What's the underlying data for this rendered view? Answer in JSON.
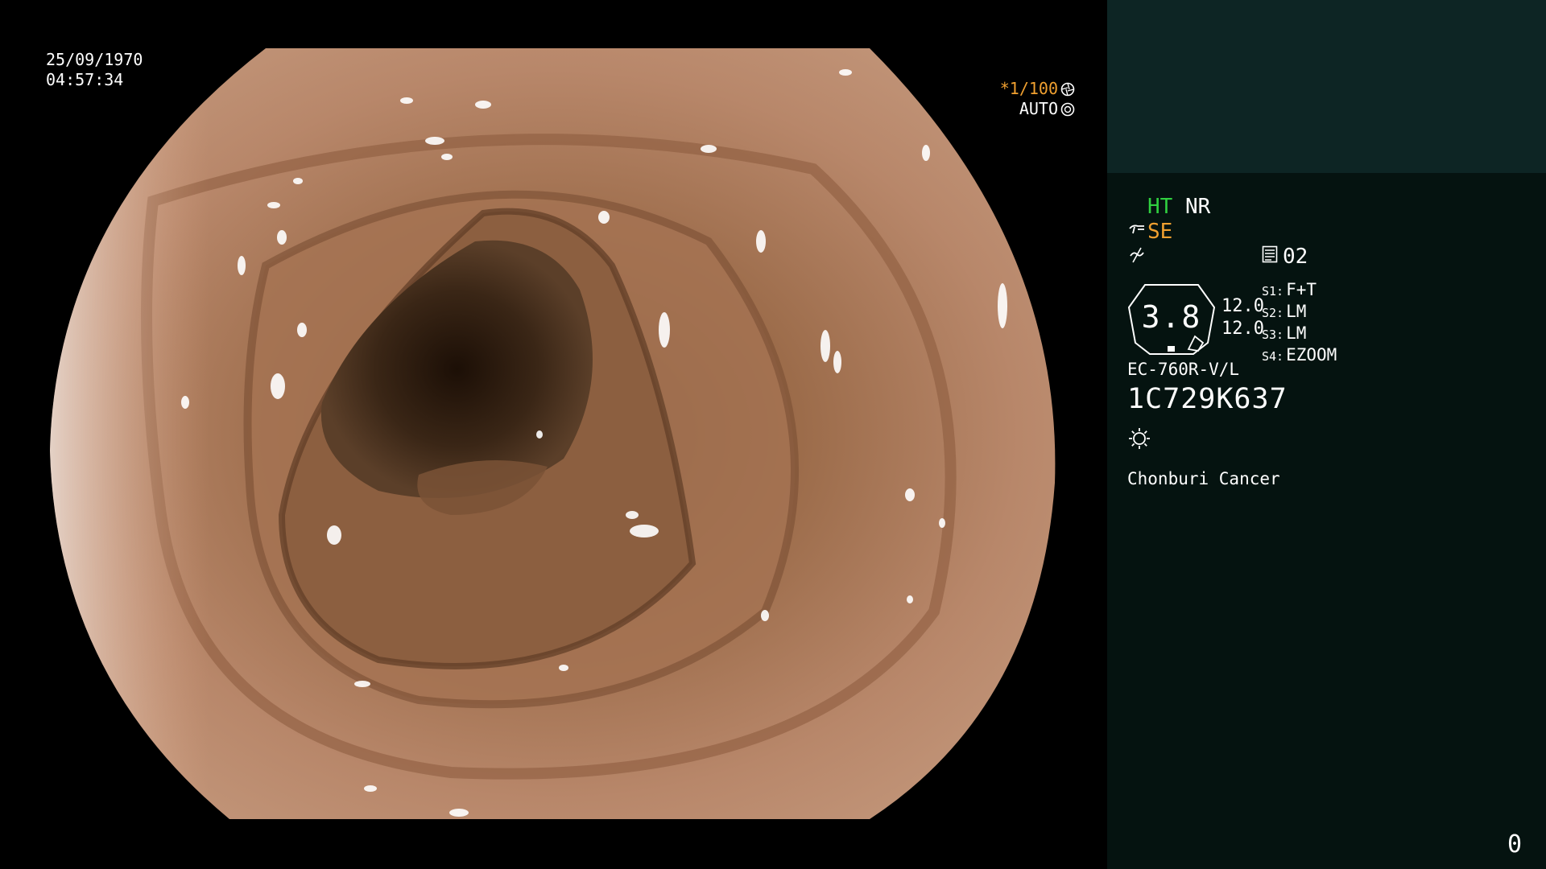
{
  "video": {
    "date": "25/09/1970",
    "time": "04:57:34",
    "shutter": "*1/100",
    "shutter_icon": "aperture-icon",
    "iris": "AUTO",
    "iris_icon": "iris-icon"
  },
  "panel": {
    "ht": "HT",
    "nr": "NR",
    "se": "SE",
    "memory": "02",
    "zoom": "3.8",
    "scale_top": "12.0",
    "scale_bottom": "12.0",
    "switches": [
      {
        "key": "S1:",
        "value": "F+T"
      },
      {
        "key": "S2:",
        "value": "LM"
      },
      {
        "key": "S3:",
        "value": "LM"
      },
      {
        "key": "S4:",
        "value": "EZOOM"
      }
    ],
    "model": "EC-760R-V/L",
    "serial": "1C729K637",
    "hospital": "Chonburi Cancer",
    "counter": "0"
  },
  "colors": {
    "ht_green": "#30d040",
    "se_amber": "#f0a030",
    "panel_bg": "#051310",
    "panel_top_bg": "#0d2524"
  }
}
